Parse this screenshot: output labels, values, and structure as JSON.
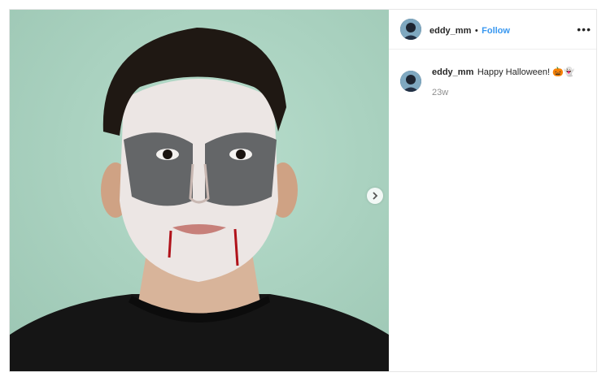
{
  "post": {
    "image_alt": "Boy with Halloween vampire face paint",
    "next_icon": "chevron-right-icon"
  },
  "header": {
    "username": "eddy_mm",
    "separator": "•",
    "follow_label": "Follow",
    "more_icon": "more-horizontal-icon",
    "more_label": "•••"
  },
  "caption": {
    "username": "eddy_mm",
    "text": "Happy Halloween! 🎃👻",
    "time": "23w"
  },
  "colors": {
    "follow_blue": "#3897f0",
    "background_wall": "#a9d2c0",
    "text_primary": "#262626",
    "text_muted": "#8e8e8e"
  }
}
